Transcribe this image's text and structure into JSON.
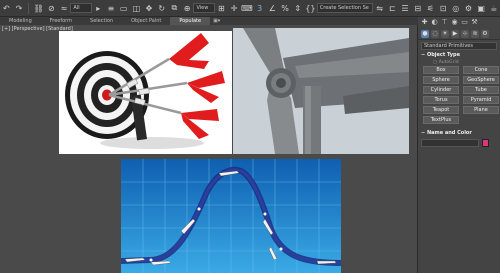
{
  "toolbar": {
    "undo_icon": "undo-icon",
    "redo_icon": "redo-icon",
    "filter_value": "All",
    "view_value": "View",
    "selection_set_value": "Create Selection Se"
  },
  "ribbon": {
    "tabs": [
      "Modeling",
      "Freeform",
      "Selection",
      "Object Paint",
      "Populate"
    ],
    "active_tab": "Populate"
  },
  "viewport": {
    "label": "[+] [Perspective] [Standard]"
  },
  "command_panel": {
    "dropdown_value": "Standard Primitives",
    "object_type_title": "Object Type",
    "autogrid_label": "AutoGrid",
    "buttons": [
      "Box",
      "Cone",
      "Sphere",
      "GeoSphere",
      "Cylinder",
      "Tube",
      "Torus",
      "Pyramid",
      "Teapot",
      "Plane",
      "TextPlus"
    ],
    "name_color_title": "Name and Color",
    "color": "#e0347d"
  }
}
